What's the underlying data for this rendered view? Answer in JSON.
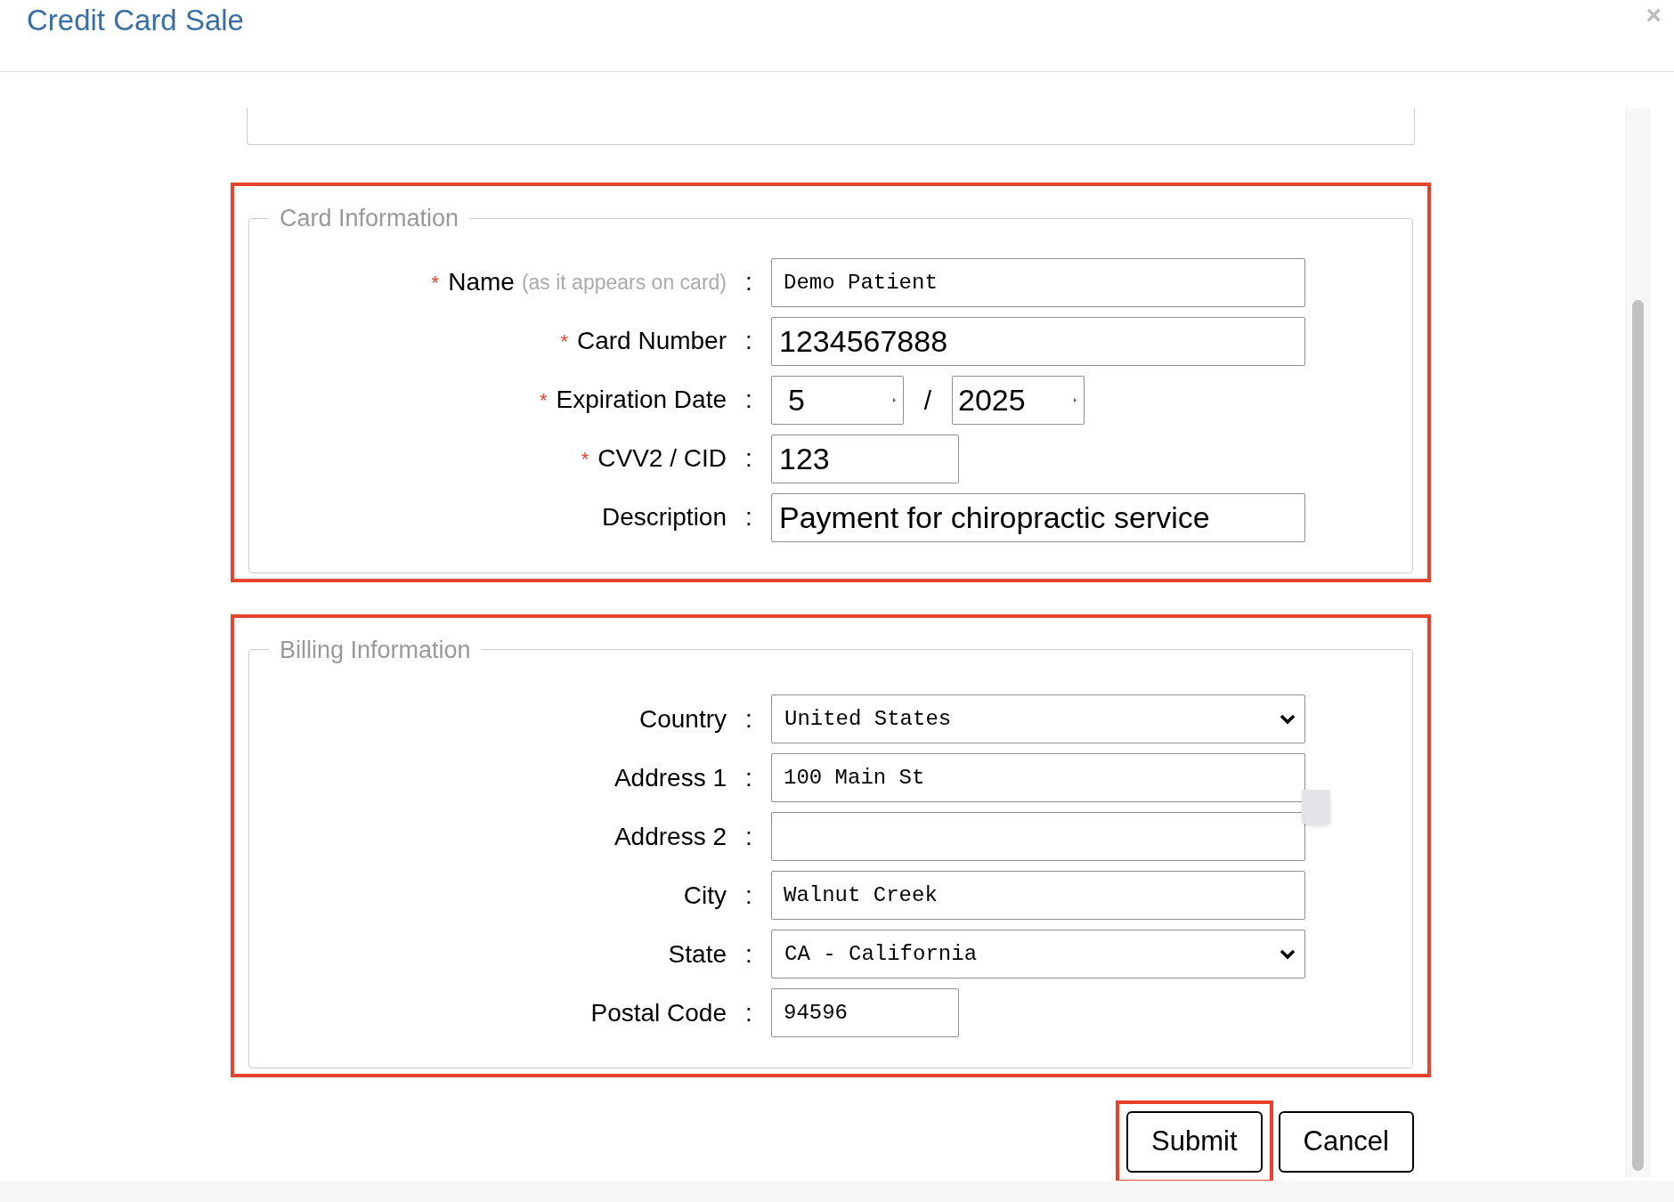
{
  "dialog": {
    "title": "Credit Card Sale",
    "close": "×"
  },
  "sections": [
    {
      "legend": "Card Information",
      "highlighted": true,
      "fields": [
        {
          "label": "Name",
          "hint": "(as it appears on card)",
          "required": true,
          "kind": "text",
          "short": false,
          "value": "Demo Patient"
        },
        {
          "label": "Card Number",
          "required": true,
          "kind": "large-text",
          "short": false,
          "value": "1234567888"
        },
        {
          "label": "Expiration Date",
          "required": true,
          "kind": "expiry",
          "short": false,
          "month": "5",
          "separator": "/",
          "year": "2025"
        },
        {
          "label": "CVV2 / CID",
          "required": true,
          "kind": "large-text",
          "short": true,
          "value": "123"
        },
        {
          "label": "Description",
          "required": false,
          "kind": "large-text",
          "short": false,
          "value": "Payment for chiropractic service"
        }
      ]
    },
    {
      "legend": "Billing Information",
      "highlighted": true,
      "fields": [
        {
          "label": "Country",
          "required": false,
          "kind": "select",
          "short": false,
          "value": "United States"
        },
        {
          "label": "Address 1",
          "required": false,
          "kind": "text",
          "short": false,
          "value": "100 Main St"
        },
        {
          "label": "Address 2",
          "required": false,
          "kind": "text",
          "short": false
        },
        {
          "label": "City",
          "required": false,
          "kind": "text",
          "short": false,
          "value": "Walnut Creek"
        },
        {
          "label": "State",
          "required": false,
          "kind": "select",
          "short": false,
          "value": "CA - California"
        },
        {
          "label": "Postal Code",
          "required": false,
          "kind": "text",
          "short": true,
          "value": "94596"
        }
      ]
    }
  ],
  "colon": ":",
  "required_mark": "*",
  "buttons": [
    {
      "label": "Submit",
      "highlighted": true
    },
    {
      "label": "Cancel",
      "highlighted": false
    }
  ]
}
